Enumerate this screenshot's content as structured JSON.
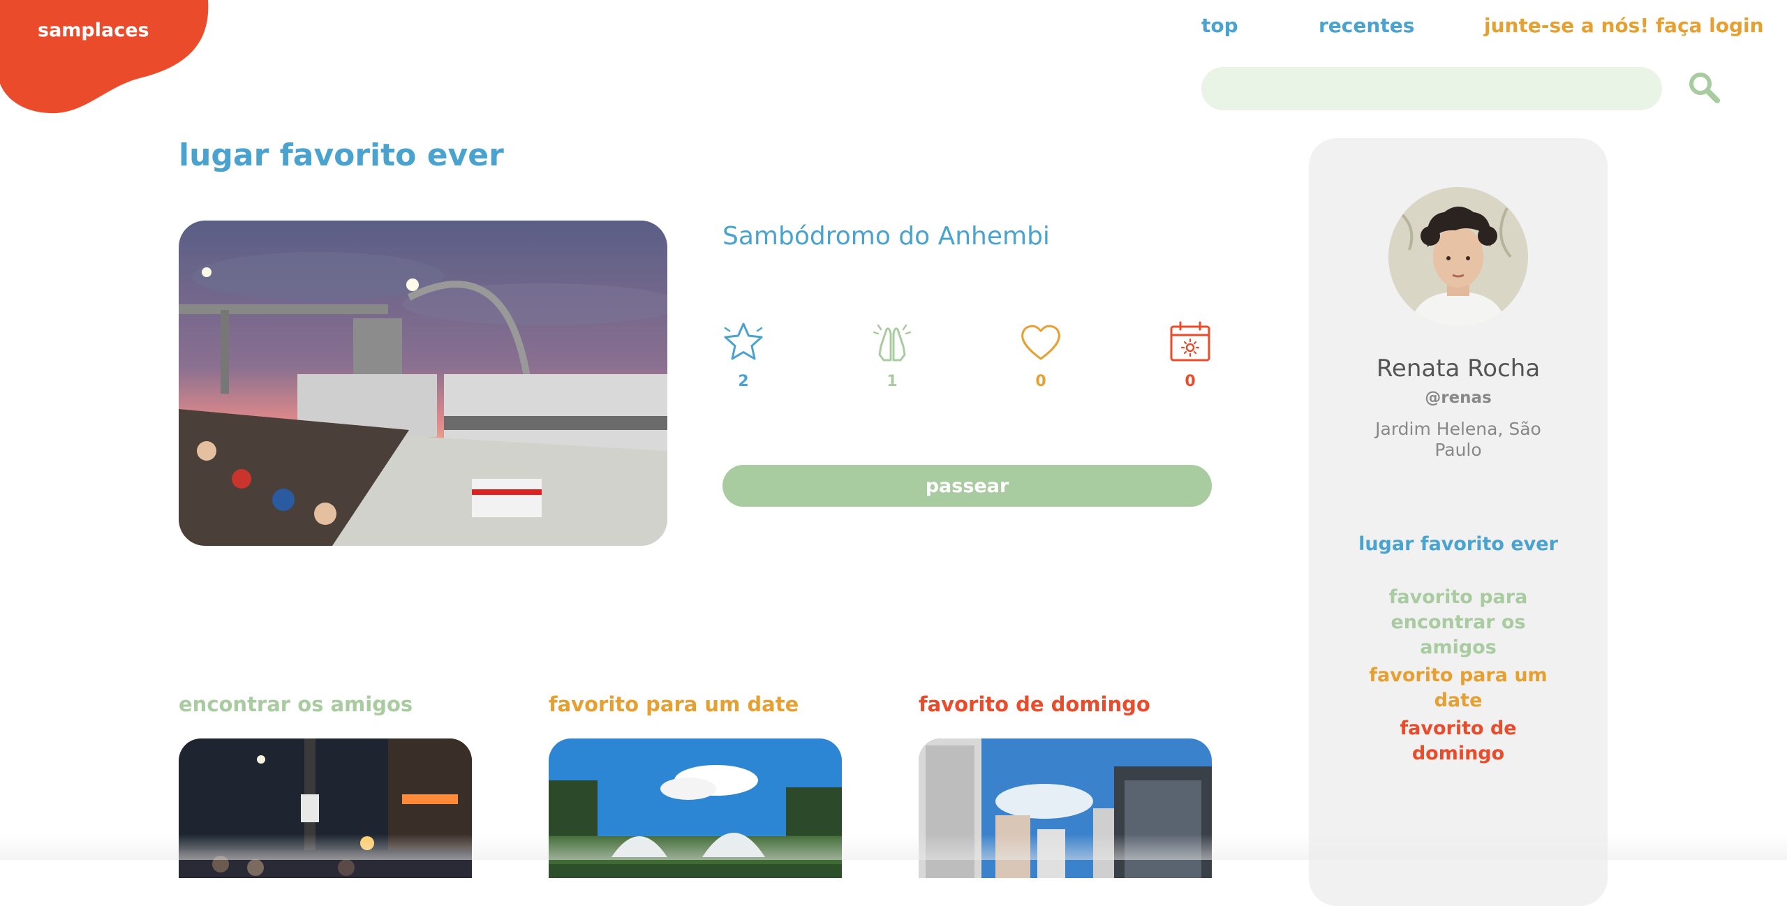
{
  "brand": {
    "name": "samplaces",
    "color": "#ea4b2a"
  },
  "nav": {
    "top": "top",
    "recentes": "recentes",
    "login": "junte-se a nós! faça login"
  },
  "search": {
    "placeholder": ""
  },
  "main": {
    "title": "lugar favorito ever",
    "place_name": "Sambódromo do Anhembi",
    "stats": [
      {
        "icon": "star-icon",
        "count": "2",
        "color": "#4aa3cf"
      },
      {
        "icon": "praying-hands-icon",
        "count": "1",
        "color": "#a8cba0"
      },
      {
        "icon": "heart-icon",
        "count": "0",
        "color": "#e6a032"
      },
      {
        "icon": "calendar-sun-icon",
        "count": "0",
        "color": "#ea4b2a"
      }
    ],
    "button_label": "passear"
  },
  "sections": [
    {
      "title": "encontrar os amigos",
      "color": "#a8cba0"
    },
    {
      "title": "favorito para um date",
      "color": "#e6a032"
    },
    {
      "title": "favorito de domingo",
      "color": "#ea4b2a"
    }
  ],
  "profile": {
    "name": "Renata Rocha",
    "handle": "@renas",
    "location": "Jardim Helena, São Paulo",
    "links": [
      {
        "label": "lugar favorito ever",
        "color": "#4aa3cf"
      },
      {
        "label": "favorito para encontrar os amigos",
        "color": "#a8cba0"
      },
      {
        "label": "favorito para um date",
        "color": "#e6a032"
      },
      {
        "label": "favorito de domingo",
        "color": "#ea4b2a"
      }
    ]
  }
}
